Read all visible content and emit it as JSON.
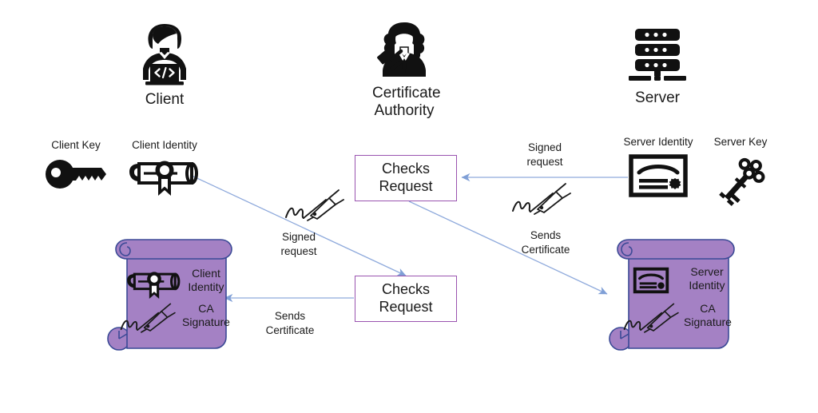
{
  "diagram": {
    "title_visible": false,
    "background": "#ffffff",
    "colors": {
      "arrow": "#8faadc",
      "arrow_dark": "#4472c4",
      "box_border": "#9a54b0",
      "box_fill": "#ffffff",
      "scroll_fill": "#a481c4",
      "scroll_border": "#3b4a96",
      "icon_black": "#111111",
      "text": "#1a1a1a"
    }
  },
  "actors": [
    {
      "id": "client",
      "label": "Client",
      "icon": "person-with-laptop-icon"
    },
    {
      "id": "ca",
      "label": "Certificate\nAuthority",
      "icon": "judge-with-gavel-icon"
    },
    {
      "id": "server",
      "label": "Server",
      "icon": "server-rack-icon"
    }
  ],
  "assets": [
    {
      "id": "client-key",
      "label": "Client Key",
      "icon": "key-icon"
    },
    {
      "id": "client-identity",
      "label": "Client Identity",
      "icon": "diploma-scroll-seal-icon"
    },
    {
      "id": "server-identity",
      "label": "Server Identity",
      "icon": "framed-certificate-icon"
    },
    {
      "id": "server-key",
      "label": "Server Key",
      "icon": "skeleton-key-icon"
    }
  ],
  "process_boxes": [
    {
      "id": "checks-request-top",
      "label": "Checks\nRequest"
    },
    {
      "id": "checks-request-bottom",
      "label": "Checks\nRequest"
    }
  ],
  "edge_labels": [
    {
      "id": "signed-request-server",
      "label": "Signed\nrequest",
      "icon": "signature-pen-icon"
    },
    {
      "id": "signed-request-client",
      "label": "Signed\nrequest",
      "icon": "signature-pen-icon"
    },
    {
      "id": "sends-certificate-server",
      "label": "Sends\nCertificate",
      "icon": "signature-pen-icon"
    },
    {
      "id": "sends-certificate-client",
      "label": "Sends\nCertificate",
      "icon": null
    }
  ],
  "certificates": [
    {
      "id": "client-certificate",
      "identity_label": "Client\nIdentity",
      "signature_label": "CA\nSignature",
      "identity_icon": "diploma-scroll-seal-icon",
      "signature_icon": "signature-pen-icon"
    },
    {
      "id": "server-certificate",
      "identity_label": "Server\nIdentity",
      "signature_label": "CA\nSignature",
      "identity_icon": "framed-certificate-icon",
      "signature_icon": "signature-pen-icon"
    }
  ]
}
